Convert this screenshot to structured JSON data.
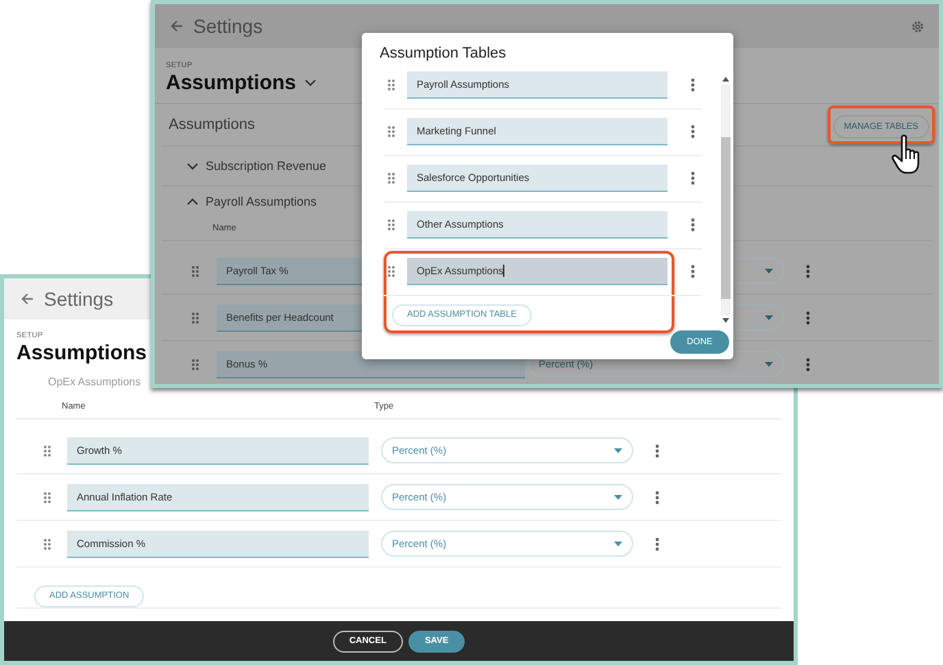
{
  "back_window": {
    "title": "Settings",
    "setup_label": "SETUP",
    "page_title": "Assumptions",
    "section_title": "Assumptions",
    "manage_button": {
      "label": "MANAGE TABLES",
      "highlighted": true
    },
    "groups": [
      {
        "title": "Subscription Revenue",
        "expanded": false
      },
      {
        "title": "Payroll Assumptions",
        "expanded": true,
        "column_1": "Name",
        "rows": [
          {
            "name": "Payroll Tax %"
          },
          {
            "name": "Benefits per Headcount"
          },
          {
            "name": "Bonus %",
            "type": "Percent (%)"
          }
        ]
      }
    ]
  },
  "dialog": {
    "title": "Assumption Tables",
    "tables": [
      {
        "name": "Payroll Assumptions",
        "highlighted": false
      },
      {
        "name": "Marketing Funnel",
        "highlighted": false
      },
      {
        "name": "Salesforce Opportunities",
        "highlighted": false
      },
      {
        "name": "Other Assumptions",
        "highlighted": false
      },
      {
        "name": "OpEx Assumptions",
        "highlighted": true
      }
    ],
    "add_button": "ADD ASSUMPTION TABLE",
    "done_button": "DONE"
  },
  "front_window": {
    "title": "Settings",
    "setup_label": "SETUP",
    "page_title": "Assumptions",
    "group_title": "OpEx Assumptions",
    "columns": [
      "Name",
      "Type"
    ],
    "rows": [
      {
        "name": "Growth %",
        "type": "Percent (%)"
      },
      {
        "name": "Annual Inflation Rate",
        "type": "Percent (%)"
      },
      {
        "name": "Commission %",
        "type": "Percent (%)"
      }
    ],
    "add_button": "ADD ASSUMPTION",
    "footer_buttons": [
      {
        "label": "CANCEL",
        "kind": "secondary"
      },
      {
        "label": "SAVE",
        "kind": "primary"
      }
    ]
  }
}
